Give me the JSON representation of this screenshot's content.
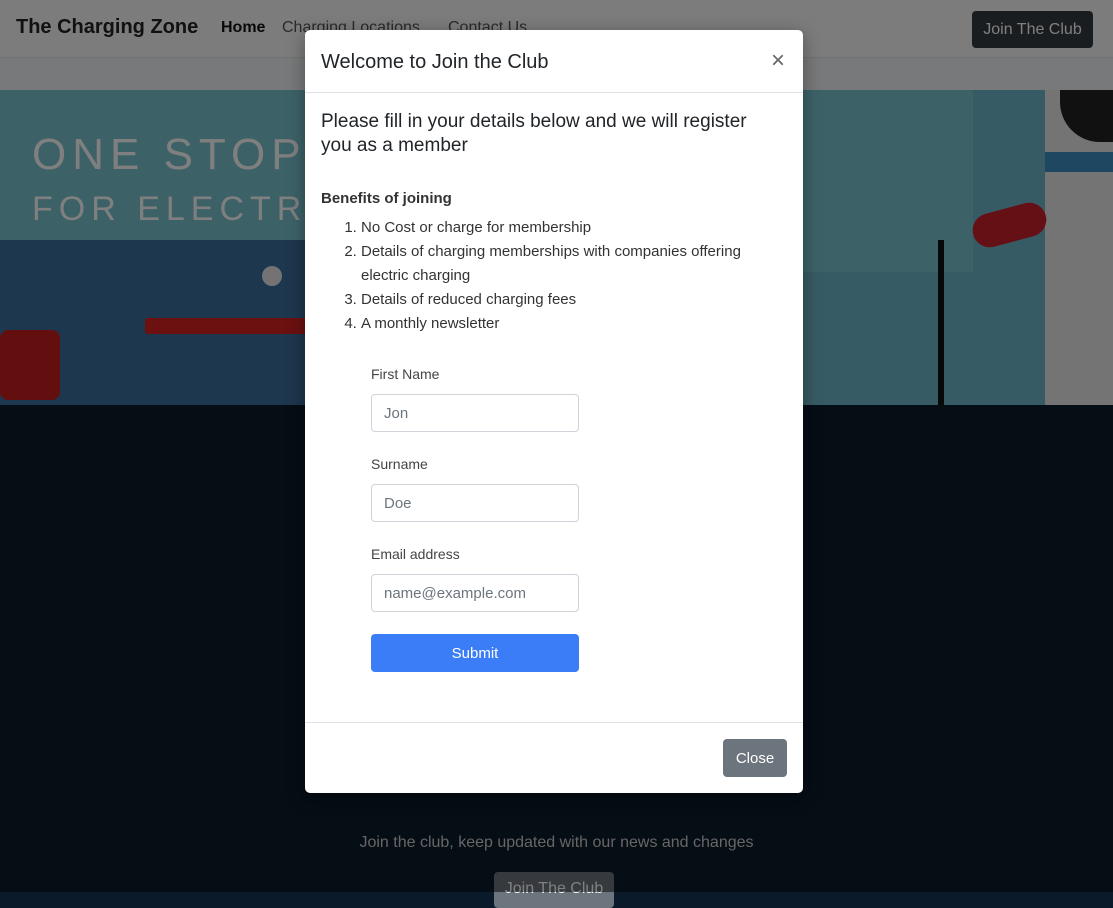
{
  "navbar": {
    "brand": "The Charging Zone",
    "links": [
      "Home",
      "Charging Locations",
      "Contact Us"
    ],
    "join_button": "Join The Club"
  },
  "hero": {
    "line1": "ONE STOP",
    "line2": "FOR ELECTRIC"
  },
  "footer": {
    "text": "Join the club, keep updated with our news and changes",
    "button": "Join The Club"
  },
  "modal": {
    "title": "Welcome to Join the Club",
    "close_symbol": "×",
    "intro": "Please fill in your details below and we will register you as a member",
    "benefits_heading": "Benefits of joining",
    "benefits": [
      "No Cost or charge for membership",
      "Details of charging memberships with companies offering electric charging",
      "Details of reduced charging fees",
      "A monthly newsletter"
    ],
    "form": {
      "first_name_label": "First Name",
      "first_name_placeholder": "Jon",
      "surname_label": "Surname",
      "surname_placeholder": "Doe",
      "email_label": "Email address",
      "email_placeholder": "name@example.com",
      "submit_label": "Submit"
    },
    "footer_close_label": "Close"
  },
  "colors": {
    "primary": "#3b7cf7",
    "secondary": "#6c757d",
    "dark": "#343a40"
  }
}
